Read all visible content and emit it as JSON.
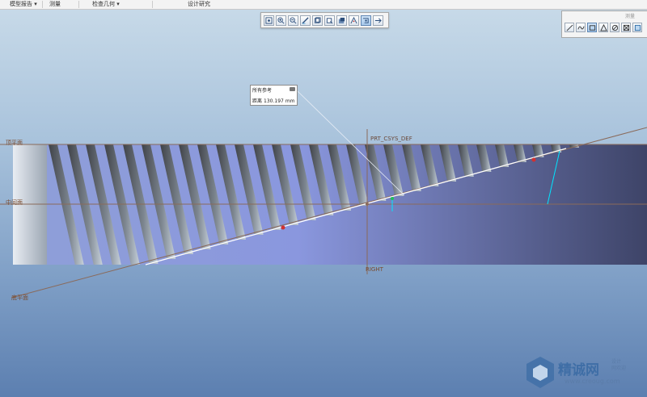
{
  "menubar": {
    "items": [
      {
        "label": "模型报告",
        "has_dropdown": true
      },
      {
        "label": "测量",
        "has_dropdown": false
      },
      {
        "label": "检查几何",
        "has_dropdown": true
      },
      {
        "label": "设计研究",
        "has_dropdown": false
      }
    ]
  },
  "view_toolbar": {
    "icons": [
      "zoom-window-icon",
      "zoom-in-icon",
      "zoom-out-icon",
      "repaint-icon",
      "saved-views-icon",
      "orient-icon",
      "display-style-icon",
      "datum-display-icon",
      "spin-center-icon",
      "annotation-display-icon"
    ]
  },
  "sketch_toolbar": {
    "header": "测量",
    "icons": [
      "line-icon",
      "spline-icon",
      "rectangle-icon",
      "arc-icon",
      "circle-icon",
      "fillet-icon",
      "chamfer-icon"
    ]
  },
  "reference_popup": {
    "title": "所有参考",
    "distance_label": "距离",
    "distance_value": "130.197",
    "distance_unit": "mm"
  },
  "datums": {
    "csys": "PRT_CSYS_DEF",
    "right_plane": "RIGHT",
    "top_plane": "顶平面",
    "front_plane": "中间面",
    "bottom_plane": "底平面"
  },
  "watermark": {
    "brand": "精诚网",
    "sub_line1": "设计",
    "sub_line2": "网欢迎",
    "url": "www.creoug.com"
  },
  "colors": {
    "sketch_line": "#ffffff",
    "dimension_line": "#00e5ff",
    "datum_plane": "#8a6a5a",
    "constraint_point": "#d23030"
  }
}
